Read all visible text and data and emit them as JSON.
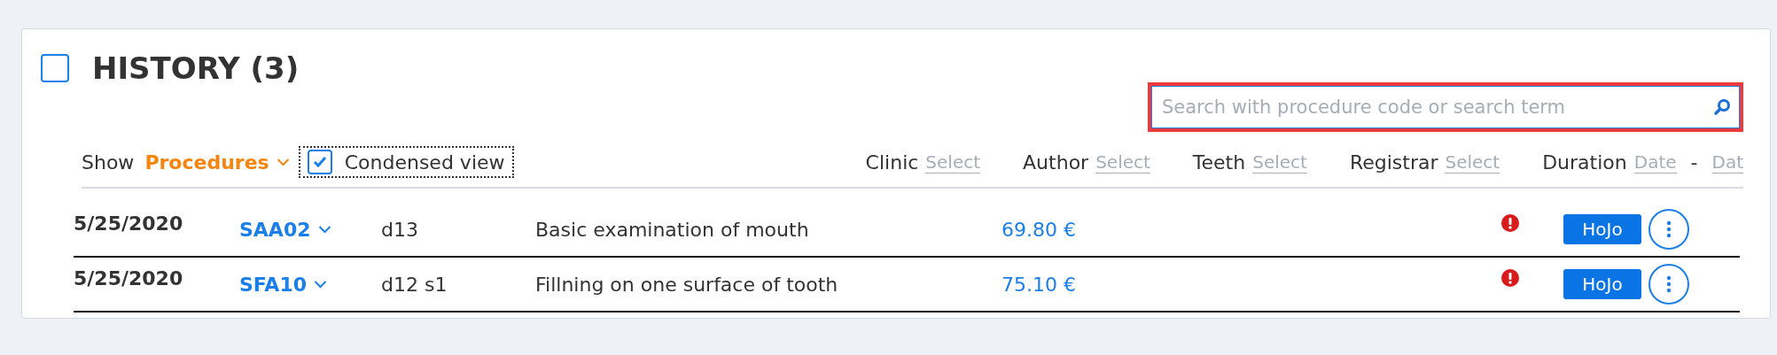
{
  "header": {
    "title": "HISTORY (3)",
    "select_all_checked": false
  },
  "search": {
    "placeholder": "Search with procedure code or search term",
    "highlighted": true
  },
  "show": {
    "label": "Show",
    "value": "Procedures"
  },
  "condensed_view": {
    "label": "Condensed view",
    "checked": true
  },
  "filters": [
    {
      "kind": "select",
      "label": "Clinic",
      "placeholder": "Select"
    },
    {
      "kind": "select",
      "label": "Author",
      "placeholder": "Select"
    },
    {
      "kind": "select",
      "label": "Teeth",
      "placeholder": "Select"
    },
    {
      "kind": "select",
      "label": "Registrar",
      "placeholder": "Select"
    },
    {
      "kind": "range",
      "label": "Duration",
      "from_placeholder": "Date",
      "separator": "-",
      "to_placeholder": "Dat"
    }
  ],
  "rows": [
    {
      "date": "5/25/2020",
      "code": "SAA02",
      "tooth": "d13",
      "description": "Basic examination of mouth",
      "price": "69.80 €",
      "warning": true,
      "author": "HoJo"
    },
    {
      "date": "5/25/2020",
      "code": "SFA10",
      "tooth": "d12 s1",
      "description": "Fillning on one surface of tooth",
      "price": "75.10 €",
      "warning": true,
      "author": "HoJo"
    }
  ]
}
